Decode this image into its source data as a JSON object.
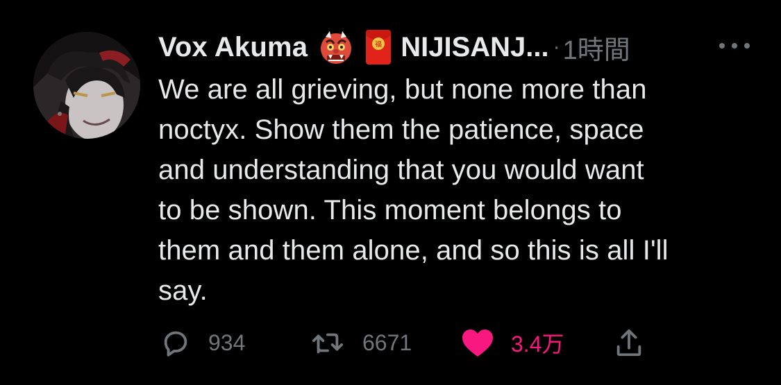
{
  "author": {
    "display_name": "Vox Akuma",
    "handle": "NIJISANJ...",
    "emoji_1": "oni-mask-emoji",
    "emoji_2": "red-envelope-emoji"
  },
  "meta": {
    "separator": "·",
    "timestamp": "1時間"
  },
  "tweet": {
    "text": "We are all grieving, but none more than\nnoctyx. Show them the patience, space\nand understanding that you would want\nto be shown. This moment belongs to\nthem and them alone, and so this is all I'll\nsay."
  },
  "actions": {
    "reply": {
      "icon": "reply-icon",
      "count": "934"
    },
    "retweet": {
      "icon": "retweet-icon",
      "count": "6671"
    },
    "like": {
      "icon": "heart-icon",
      "count": "3.4万",
      "liked": true
    },
    "share": {
      "icon": "share-icon"
    }
  },
  "colors": {
    "background": "#000000",
    "text_primary": "#e7e9ea",
    "text_secondary": "#71767b",
    "like_active": "#f91880"
  }
}
